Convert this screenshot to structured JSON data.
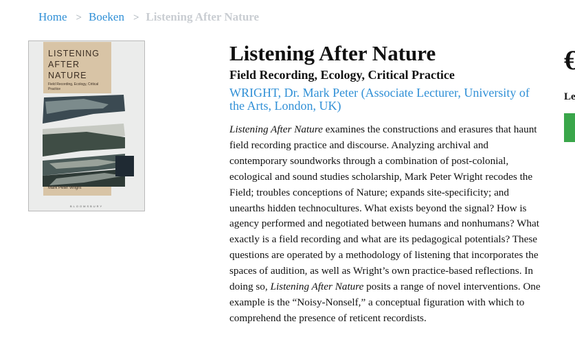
{
  "breadcrumb": {
    "home": "Home",
    "separator": ">",
    "section": "Boeken",
    "current": "Listening After Nature"
  },
  "cover": {
    "title_line1": "LISTENING",
    "title_line2": "AFTER",
    "title_line3": "NATURE",
    "subtitle": "Field Recording, Ecology, Critical Practice",
    "author": "Mark Peter Wright",
    "publisher": "BLOOMSBURY"
  },
  "product": {
    "title": "Listening After Nature",
    "subtitle": "Field Recording, Ecology, Critical Practice",
    "author": "WRIGHT, Dr. Mark Peter (Associate Lecturer, University of the Arts, London, UK)",
    "description_title_1": "Listening After Nature",
    "description_part_1": " examines the constructions and erasures that haunt field recording practice and discourse. Analyzing archival and contemporary soundworks through a combination of post-colonial, ecological and sound studies scholarship, Mark Peter Wright recodes the Field; troubles conceptions of Nature; expands site-specificity; and unearths hidden technocultures. What exists beyond the signal? How is agency performed and negotiated between humans and nonhumans? What exactly is a field recording and what are its pedagogical potentials? These questions are operated by a methodology of listening that incorporates the spaces of audition, as well as Wright’s own practice-based reflections. In doing so, ",
    "description_title_2": "Listening After Nature",
    "description_part_2": " posits a range of novel interventions. One example is the “Noisy-Nonself,” a conceptual figuration with which to comprehend the presence of reticent recordists."
  },
  "sidebar": {
    "price_fragment": "€",
    "label_fragment": "Le"
  },
  "colors": {
    "link": "#2f8fd6",
    "breadcrumb_current": "#c9cdd2",
    "button": "#3aa64a"
  }
}
